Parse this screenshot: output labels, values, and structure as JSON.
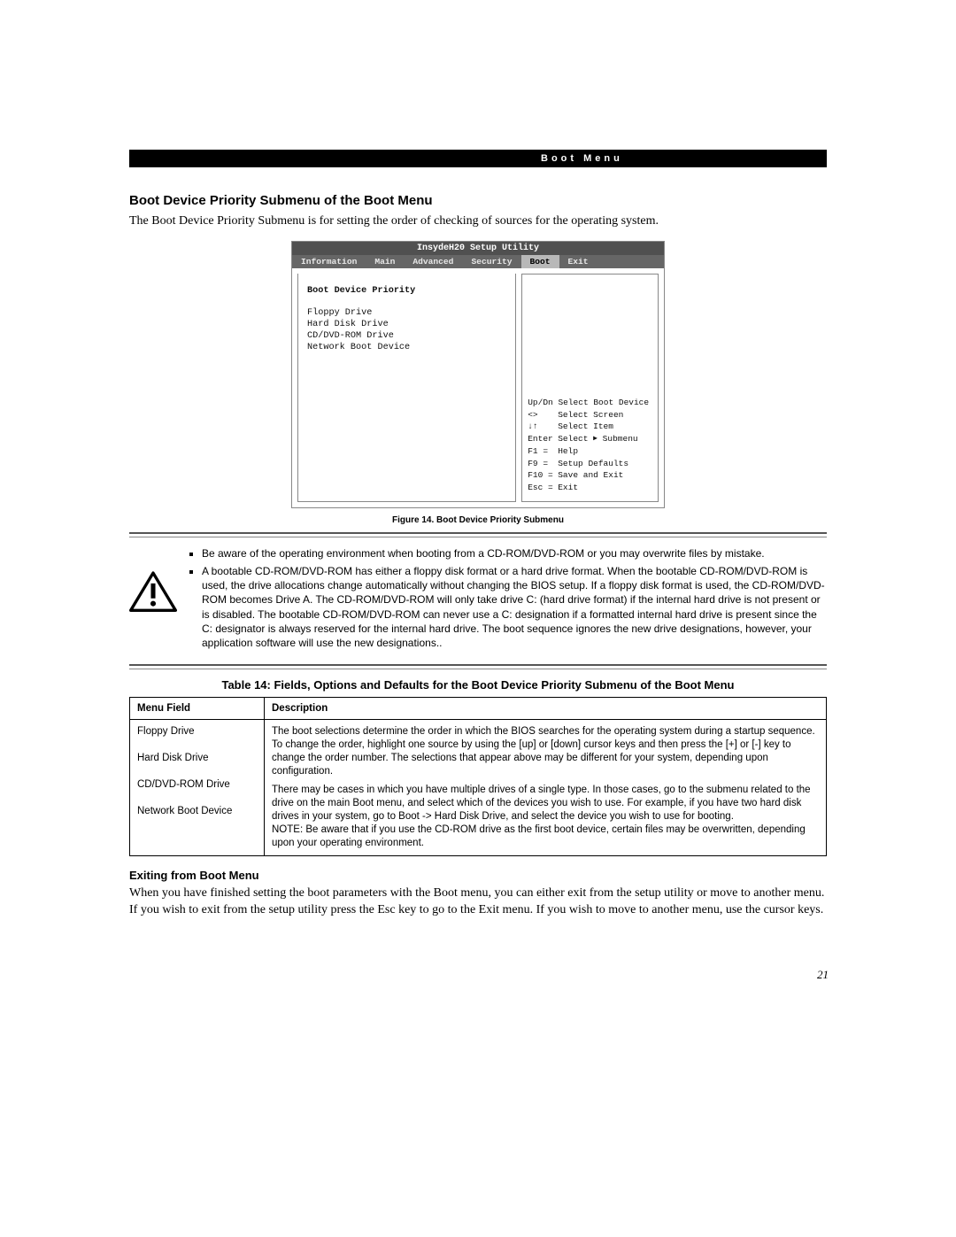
{
  "header_bar": "Boot Menu",
  "heading": "Boot Device Priority Submenu of the Boot Menu",
  "intro": "The Boot Device Priority Submenu is for setting the order of checking of sources for the operating system.",
  "bios": {
    "title": "InsydeH20 Setup Utility",
    "tabs": [
      "Information",
      "Main",
      "Advanced",
      "Security",
      "Boot",
      "Exit"
    ],
    "active_tab": "Boot",
    "left_header": "Boot Device Priority",
    "left_items": [
      "Floppy Drive",
      "Hard Disk Drive",
      "CD/DVD-ROM Drive",
      "Network Boot Device"
    ],
    "help": [
      {
        "key": "Up/Dn",
        "label": "Select Boot Device"
      },
      {
        "key": "<>",
        "label": "Select Screen"
      },
      {
        "key": "↓↑",
        "label": "Select Item"
      },
      {
        "key": "Enter",
        "label": "Select ▸ Submenu"
      },
      {
        "key": "F1  =",
        "label": "Help"
      },
      {
        "key": "F9  =",
        "label": "Setup Defaults"
      },
      {
        "key": "F10 =",
        "label": "Save and Exit"
      },
      {
        "key": "Esc =",
        "label": "Exit"
      }
    ]
  },
  "figure_caption": "Figure 14.  Boot Device Priority Submenu",
  "warnings": [
    "Be aware of the operating environment when booting from a CD-ROM/DVD-ROM or you may overwrite files by mistake.",
    "A bootable CD-ROM/DVD-ROM has either a floppy disk format or a hard drive format.  When the bootable CD-ROM/DVD-ROM is used, the drive allocations change automatically without changing the BIOS setup.  If a floppy disk format is used, the CD-ROM/DVD-ROM becomes Drive A.  The CD-ROM/DVD-ROM will only take drive C: (hard drive format) if the internal hard drive is not present or is disabled.  The bootable CD-ROM/DVD-ROM can never use a C: designation if a formatted internal hard drive is present since the C: designator is always reserved for the internal hard drive. The boot sequence ignores the new drive designations, however, your application software will use the new designations.."
  ],
  "table_title": "Table 14: Fields, Options and Defaults for the Boot Device Priority Submenu of the Boot Menu",
  "table": {
    "headers": [
      "Menu Field",
      "Description"
    ],
    "menu_fields": [
      "Floppy Drive",
      "Hard Disk Drive",
      "CD/DVD-ROM Drive",
      "Network Boot Device"
    ],
    "description_p1": "The boot selections determine the order in which the BIOS searches for the operating system during a startup sequence. To change the order, highlight one source by using the [up] or [down] cursor keys and then press the [+] or [-] key to change the order number. The selections that appear above may be different for your system, depending upon configuration.",
    "description_p2": "There may be cases in which you have multiple drives of a single type. In those cases, go to the submenu related to the drive on the main Boot menu, and select which of the devices you wish to use. For example, if you have two hard disk drives in your system, go to Boot -> Hard Disk Drive, and select the device you wish to use for booting.",
    "description_p3": "NOTE: Be aware that if you use the CD-ROM drive as the first boot device, certain files may be overwritten, depending upon your operating environment."
  },
  "exit_heading": "Exiting from Boot Menu",
  "exit_body": "When you have finished setting the boot parameters with the Boot menu, you can either exit from the setup utility or move to another menu. If you wish to exit from the setup utility press the Esc key to go to the Exit menu. If you wish to move to another menu, use the cursor keys.",
  "page_number": "21"
}
